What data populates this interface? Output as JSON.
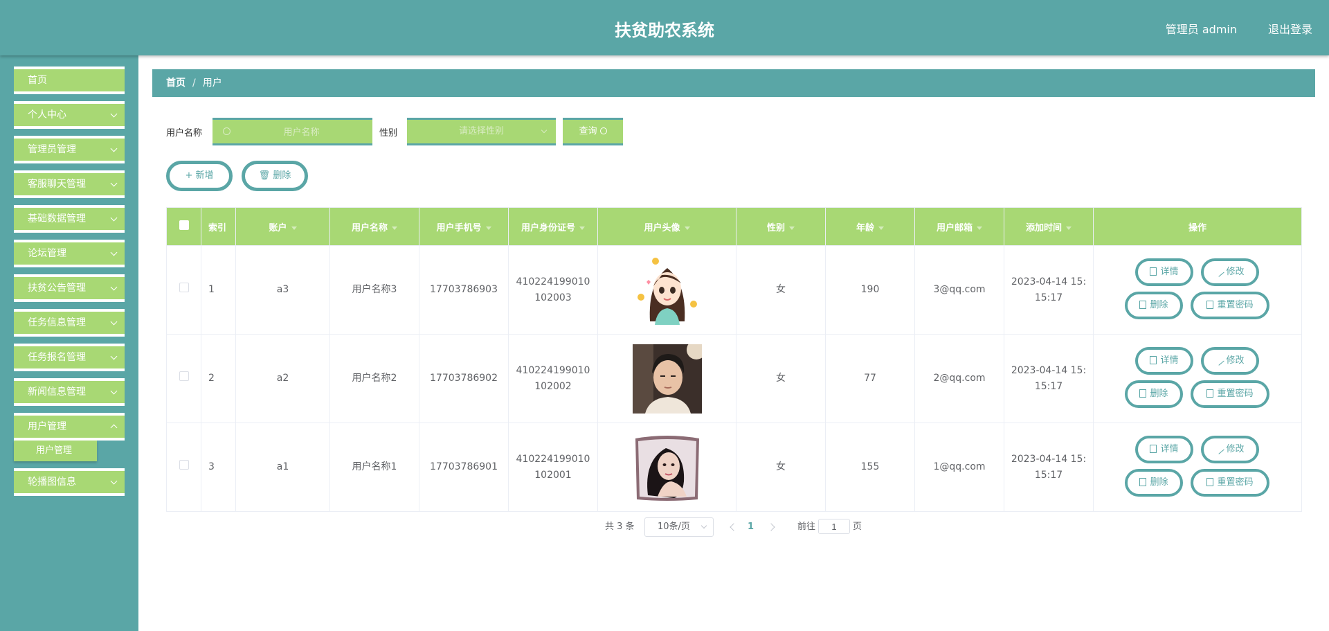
{
  "header": {
    "title": "扶贫助农系统",
    "user": "管理员 admin",
    "logout": "退出登录"
  },
  "sidebar": {
    "items": [
      {
        "label": "首页"
      },
      {
        "label": "个人中心"
      },
      {
        "label": "管理员管理"
      },
      {
        "label": "客服聊天管理"
      },
      {
        "label": "基础数据管理"
      },
      {
        "label": "论坛管理"
      },
      {
        "label": "扶贫公告管理"
      },
      {
        "label": "任务信息管理"
      },
      {
        "label": "任务报名管理"
      },
      {
        "label": "新闻信息管理"
      },
      {
        "label": "用户管理"
      },
      {
        "label": "轮播图信息"
      }
    ],
    "submenu_label": "用户管理"
  },
  "breadcrumb": {
    "home": "首页",
    "current": "用户"
  },
  "search": {
    "name_label": "用户名称",
    "name_placeholder": "用户名称",
    "gender_label": "性别",
    "gender_placeholder": "请选择性别",
    "query_label": "查询"
  },
  "actions": {
    "add": "新增",
    "delete": "删除"
  },
  "table": {
    "headers": [
      "索引",
      "账户",
      "用户名称",
      "用户手机号",
      "用户身份证号",
      "用户头像",
      "性别",
      "年龄",
      "用户邮箱",
      "添加时间",
      "操作"
    ],
    "rows": [
      {
        "index": "1",
        "account": "a3",
        "name": "用户名称3",
        "phone": "17703786903",
        "id_card": "410224199010102003",
        "gender": "女",
        "age": "190",
        "email": "3@qq.com",
        "time": "2023-04-14 15:15:17"
      },
      {
        "index": "2",
        "account": "a2",
        "name": "用户名称2",
        "phone": "17703786902",
        "id_card": "410224199010102002",
        "gender": "女",
        "age": "77",
        "email": "2@qq.com",
        "time": "2023-04-14 15:15:17"
      },
      {
        "index": "3",
        "account": "a1",
        "name": "用户名称1",
        "phone": "17703786901",
        "id_card": "410224199010102001",
        "gender": "女",
        "age": "155",
        "email": "1@qq.com",
        "time": "2023-04-14 15:15:17"
      }
    ],
    "ops": {
      "detail": "详情",
      "edit": "修改",
      "delete": "删除",
      "reset": "重置密码"
    }
  },
  "pagination": {
    "total": "共 3 条",
    "page_size": "10条/页",
    "current_page": "1",
    "goto_label": "前往",
    "goto_value": "1",
    "page_unit": "页"
  },
  "colors": {
    "teal": "#5aa6a6",
    "green": "#a8d874"
  }
}
